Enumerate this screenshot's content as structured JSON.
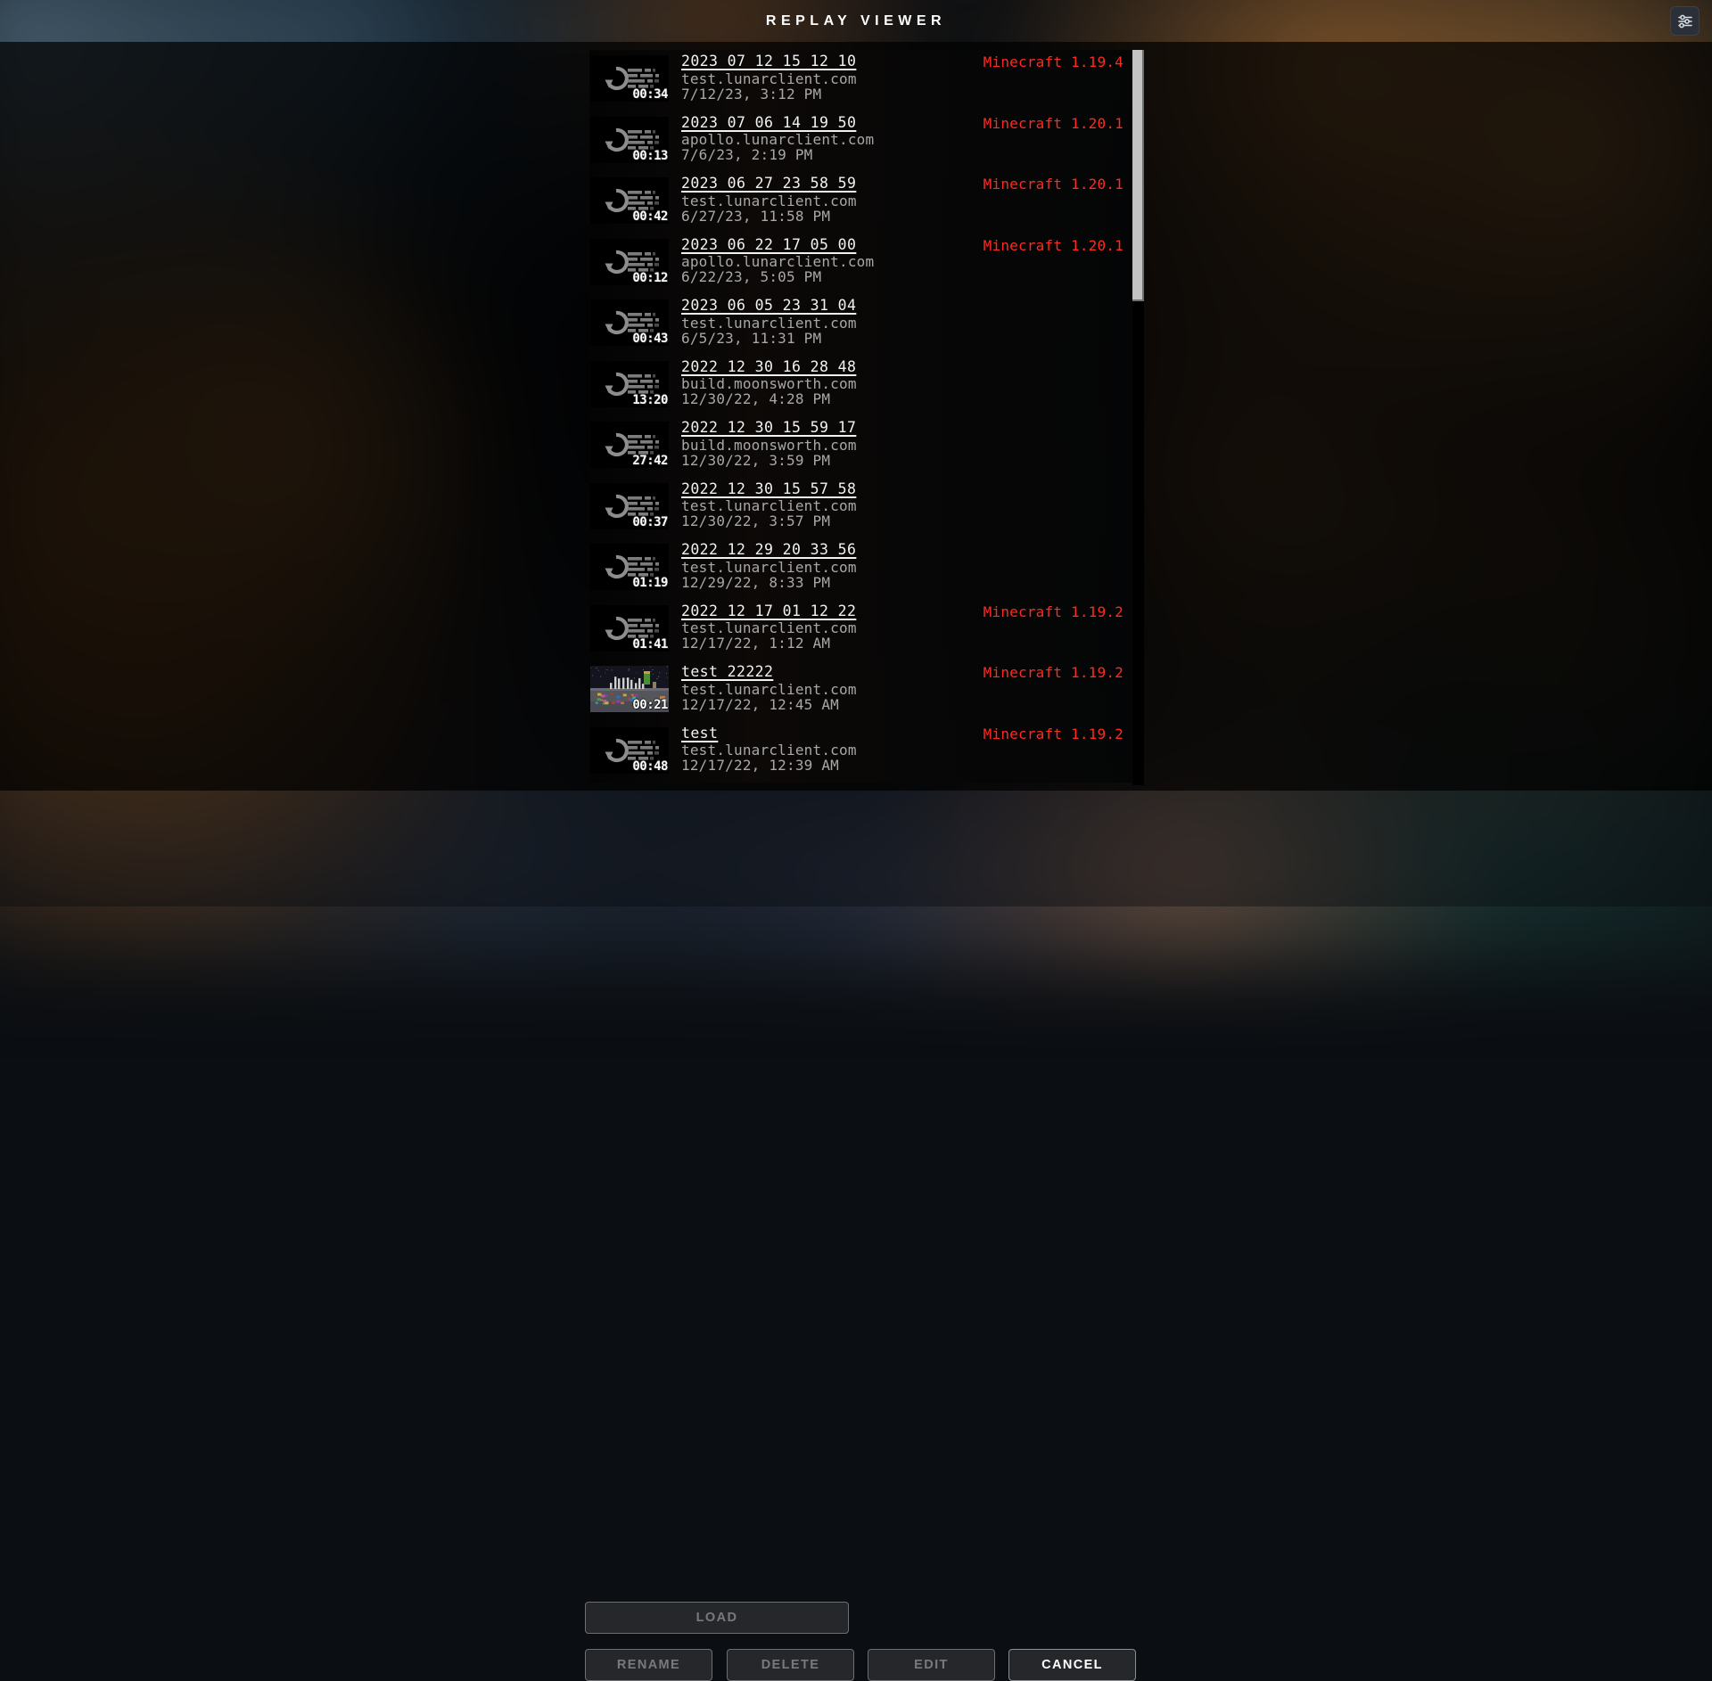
{
  "header": {
    "title": "REPLAY VIEWER",
    "settings_icon": "sliders-icon"
  },
  "list": {
    "scrollbar": {
      "position": "top",
      "thumb_ratio": 0.34
    },
    "rows": [
      {
        "title": "2023_07_12_15_12_10",
        "server": "test.lunarclient.com",
        "date": "7/12/23, 3:12 PM",
        "duration": "00:34",
        "version": "Minecraft 1.19.4",
        "thumb": "replay-icon"
      },
      {
        "title": "2023_07_06_14_19_50",
        "server": "apollo.lunarclient.com",
        "date": "7/6/23, 2:19 PM",
        "duration": "00:13",
        "version": "Minecraft 1.20.1",
        "thumb": "replay-icon"
      },
      {
        "title": "2023_06_27_23_58_59",
        "server": "test.lunarclient.com",
        "date": "6/27/23, 11:58 PM",
        "duration": "00:42",
        "version": "Minecraft 1.20.1",
        "thumb": "replay-icon"
      },
      {
        "title": "2023_06_22_17_05_00",
        "server": "apollo.lunarclient.com",
        "date": "6/22/23, 5:05 PM",
        "duration": "00:12",
        "version": "Minecraft 1.20.1",
        "thumb": "replay-icon"
      },
      {
        "title": "2023_06_05_23_31_04",
        "server": "test.lunarclient.com",
        "date": "6/5/23, 11:31 PM",
        "duration": "00:43",
        "version": "",
        "thumb": "replay-icon"
      },
      {
        "title": "2022_12_30_16_28_48",
        "server": "build.moonsworth.com",
        "date": "12/30/22, 4:28 PM",
        "duration": "13:20",
        "version": "",
        "thumb": "replay-icon"
      },
      {
        "title": "2022_12_30_15_59_17",
        "server": "build.moonsworth.com",
        "date": "12/30/22, 3:59 PM",
        "duration": "27:42",
        "version": "",
        "thumb": "replay-icon"
      },
      {
        "title": "2022_12_30_15_57_58",
        "server": "test.lunarclient.com",
        "date": "12/30/22, 3:57 PM",
        "duration": "00:37",
        "version": "",
        "thumb": "replay-icon"
      },
      {
        "title": "2022_12_29_20_33_56",
        "server": "test.lunarclient.com",
        "date": "12/29/22, 8:33 PM",
        "duration": "01:19",
        "version": "",
        "thumb": "replay-icon"
      },
      {
        "title": "2022_12_17_01_12_22",
        "server": "test.lunarclient.com",
        "date": "12/17/22, 1:12 AM",
        "duration": "01:41",
        "version": "Minecraft 1.19.2",
        "thumb": "replay-icon"
      },
      {
        "title": "test 22222",
        "server": "test.lunarclient.com",
        "date": "12/17/22, 12:45 AM",
        "duration": "00:21",
        "version": "Minecraft 1.19.2",
        "thumb": "screenshot"
      },
      {
        "title": "test",
        "server": "test.lunarclient.com",
        "date": "12/17/22, 12:39 AM",
        "duration": "00:48",
        "version": "Minecraft 1.19.2",
        "thumb": "replay-icon"
      }
    ]
  },
  "footer": {
    "load": "LOAD",
    "rename": "RENAME",
    "delete": "DELETE",
    "edit": "EDIT",
    "cancel": "CANCEL"
  },
  "colors": {
    "version_red": "#ff2a20",
    "title_white": "#f2f2f2",
    "meta_gray": "#a8a8a8",
    "scrollbar": "#c3c3c3"
  }
}
